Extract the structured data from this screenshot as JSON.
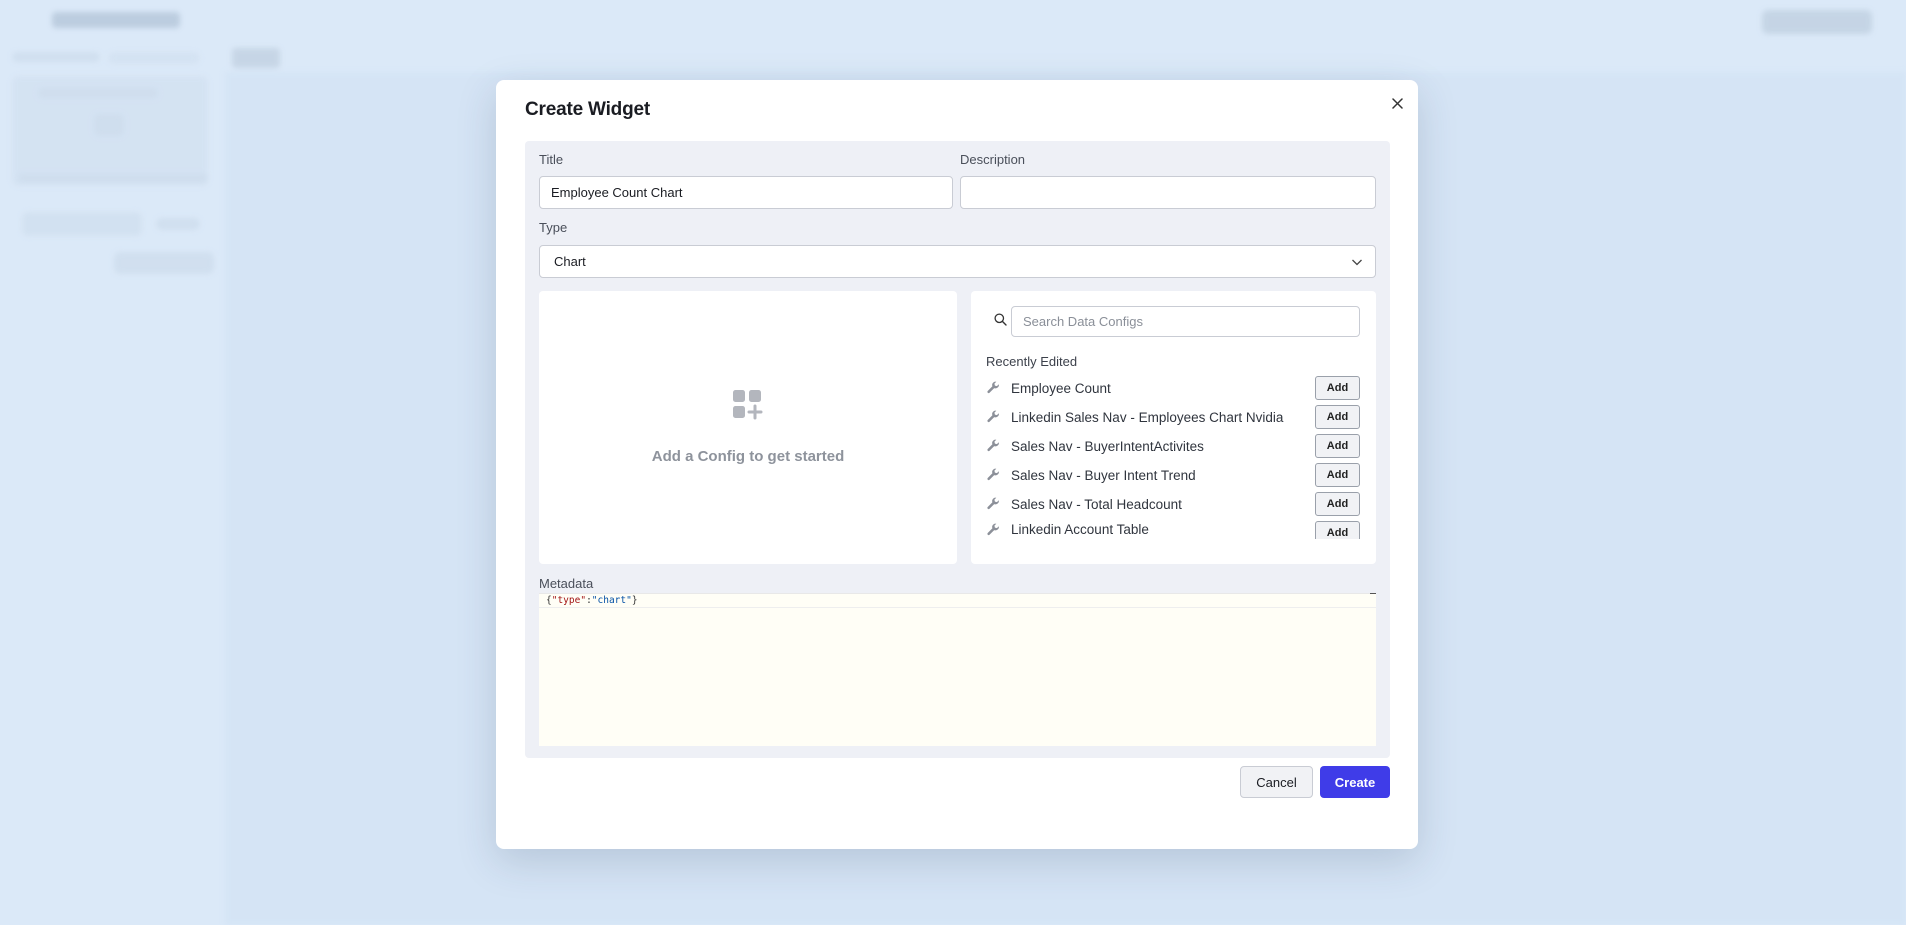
{
  "modal": {
    "title": "Create Widget",
    "close_icon": "close-icon"
  },
  "form": {
    "title_label": "Title",
    "title_value": "Employee Count Chart",
    "description_label": "Description",
    "description_value": "",
    "type_label": "Type",
    "type_value": "Chart"
  },
  "config_empty": {
    "icon": "widget-add-icon",
    "text": "Add a Config to get started"
  },
  "data_configs": {
    "search_placeholder": "Search Data Configs",
    "recent_label": "Recently Edited",
    "add_label": "Add",
    "items": [
      {
        "label": "Employee Count"
      },
      {
        "label": "Linkedin Sales Nav - Employees Chart Nvidia"
      },
      {
        "label": "Sales Nav - BuyerIntentActivites"
      },
      {
        "label": "Sales Nav - Buyer Intent Trend"
      },
      {
        "label": "Sales Nav - Total Headcount"
      },
      {
        "label": "Linkedin Account Table"
      }
    ]
  },
  "metadata": {
    "label": "Metadata",
    "code_open": "{",
    "code_key": "\"type\"",
    "code_colon": ":",
    "code_value": "\"chart\"",
    "code_close": "}"
  },
  "footer": {
    "cancel_label": "Cancel",
    "create_label": "Create"
  },
  "colors": {
    "primary": "#3f3ce8",
    "backdrop": "#dbe9f8",
    "panel": "#eef0f6"
  }
}
